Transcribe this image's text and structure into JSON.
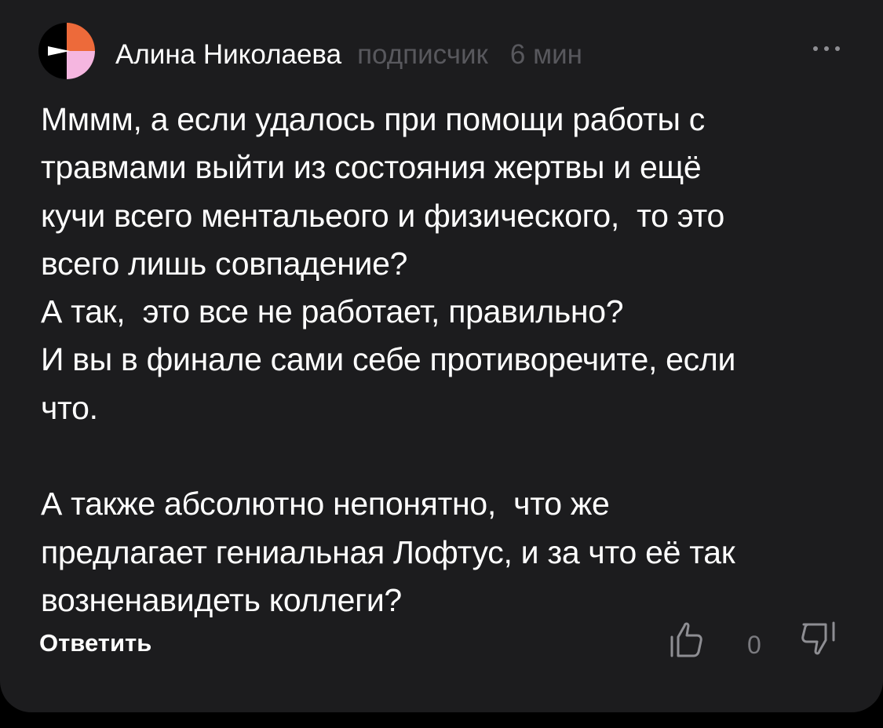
{
  "comment": {
    "author": "Алина Николаева",
    "role": "подписчик",
    "time": "6 мин",
    "avatar_colors": [
      "#ed6a3a",
      "#f5b6e0",
      "#ffffff"
    ],
    "more_icon": "ellipsis-horizontal-icon",
    "text": "Мммм, а если удалось при помощи работы с\nтравмами выйти из состояния жертвы и ещё\nкучи всего ментальеого и физического,  то это\nвсего лишь совпадение?\nА так,  это все не работает, правильно?\nИ вы в финале сами себе противоречите, если\nчто.\n\nА также абсолютно непонятно,  что же\nпредлагает гениальная Лофтус, и за что её так\nвозненавидеть коллеги?",
    "actions": {
      "reply_label": "Ответить",
      "like_icon": "thumbs-up-icon",
      "vote_count": "0",
      "dislike_icon": "thumbs-down-icon"
    }
  },
  "colors": {
    "background": "#1c1c1e",
    "text": "#ffffff",
    "muted": "#58585d",
    "icon": "#8e8e93"
  }
}
